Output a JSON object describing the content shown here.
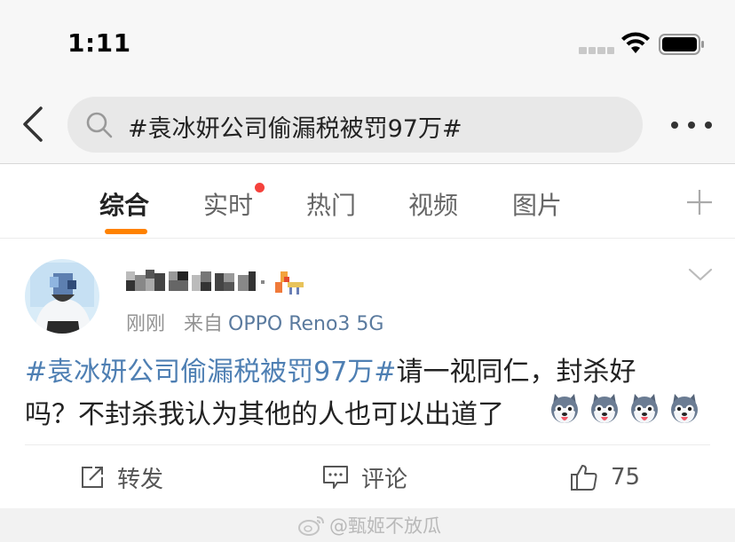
{
  "status_bar": {
    "time": "1:11"
  },
  "search": {
    "query": "#袁冰妍公司偷漏税被罚97万#"
  },
  "tabs": [
    {
      "label": "综合"
    },
    {
      "label": "实时"
    },
    {
      "label": "热门"
    },
    {
      "label": "视频"
    },
    {
      "label": "图片"
    }
  ],
  "post": {
    "time": "刚刚",
    "source_prefix": "来自",
    "device": "OPPO Reno3 5G",
    "topic": "#袁冰妍公司偷漏税被罚97万#",
    "line1_rest": "请一视同仁，封杀好",
    "line2": "吗？不封杀我认为其他的人也可以出道了",
    "emoji_names": [
      "husky-emoji",
      "husky-emoji",
      "husky-emoji",
      "husky-emoji"
    ]
  },
  "actions": {
    "repost": "转发",
    "comment": "评论",
    "like_count": "75"
  },
  "watermark": "@甄姬不放瓜",
  "colors": {
    "accent_orange": "#ff8200",
    "topic_blue": "#4e7fb3",
    "device_blue": "#5a7a9e",
    "notification_red": "#f5423c"
  }
}
